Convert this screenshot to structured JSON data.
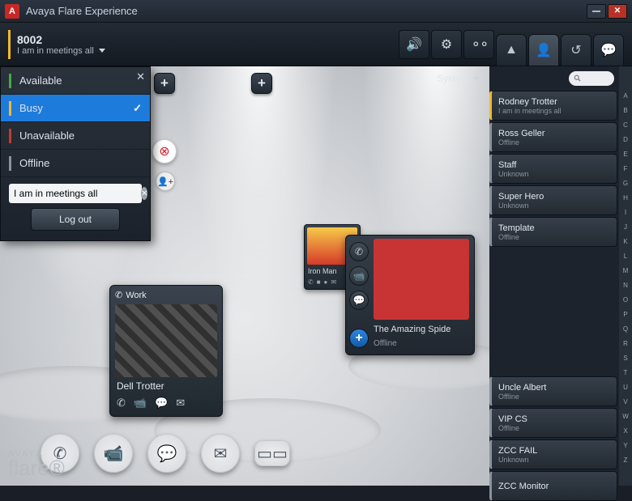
{
  "titlebar": {
    "app_title": "Avaya Flare Experience"
  },
  "topbar": {
    "extension": "8002",
    "status_message": "I am in meetings all"
  },
  "filter": {
    "label": "System"
  },
  "presence_menu": {
    "items": [
      {
        "label": "Available",
        "color": "#3fae3f"
      },
      {
        "label": "Busy",
        "color": "#f5b82e"
      },
      {
        "label": "Unavailable",
        "color": "#c23b2e"
      },
      {
        "label": "Offline",
        "color": "#8a929c"
      }
    ],
    "input_value": "I am in meetings all",
    "logout_label": "Log out"
  },
  "stage": {
    "big_card": {
      "header_label": "Work",
      "name": "Dell Trotter"
    },
    "mini_card": {
      "name": "Iron Man"
    }
  },
  "logo": {
    "brand_top": "AVAYA",
    "brand_bottom": "flare®"
  },
  "popup": {
    "name": "The Amazing Spide",
    "status": "Offline"
  },
  "contacts": [
    {
      "name": "Rodney Trotter",
      "status": "I am in meetings all",
      "busy": true
    },
    {
      "name": "Ross Geller",
      "status": "Offline"
    },
    {
      "name": "Staff",
      "status": "Unknown"
    },
    {
      "name": "Super Hero",
      "status": "Unknown"
    },
    {
      "name": "Template",
      "status": "Offline"
    },
    {
      "name": "Uncle Albert",
      "status": "Offline"
    },
    {
      "name": "VIP CS",
      "status": "Offline"
    },
    {
      "name": "ZCC FAIL",
      "status": "Unknown"
    },
    {
      "name": "ZCC Monitor",
      "status": ""
    }
  ],
  "alpha_index": [
    "A",
    "B",
    "C",
    "D",
    "E",
    "F",
    "G",
    "H",
    "I",
    "J",
    "K",
    "L",
    "M",
    "N",
    "O",
    "P",
    "Q",
    "R",
    "S",
    "T",
    "U",
    "V",
    "W",
    "X",
    "Y",
    "Z"
  ]
}
